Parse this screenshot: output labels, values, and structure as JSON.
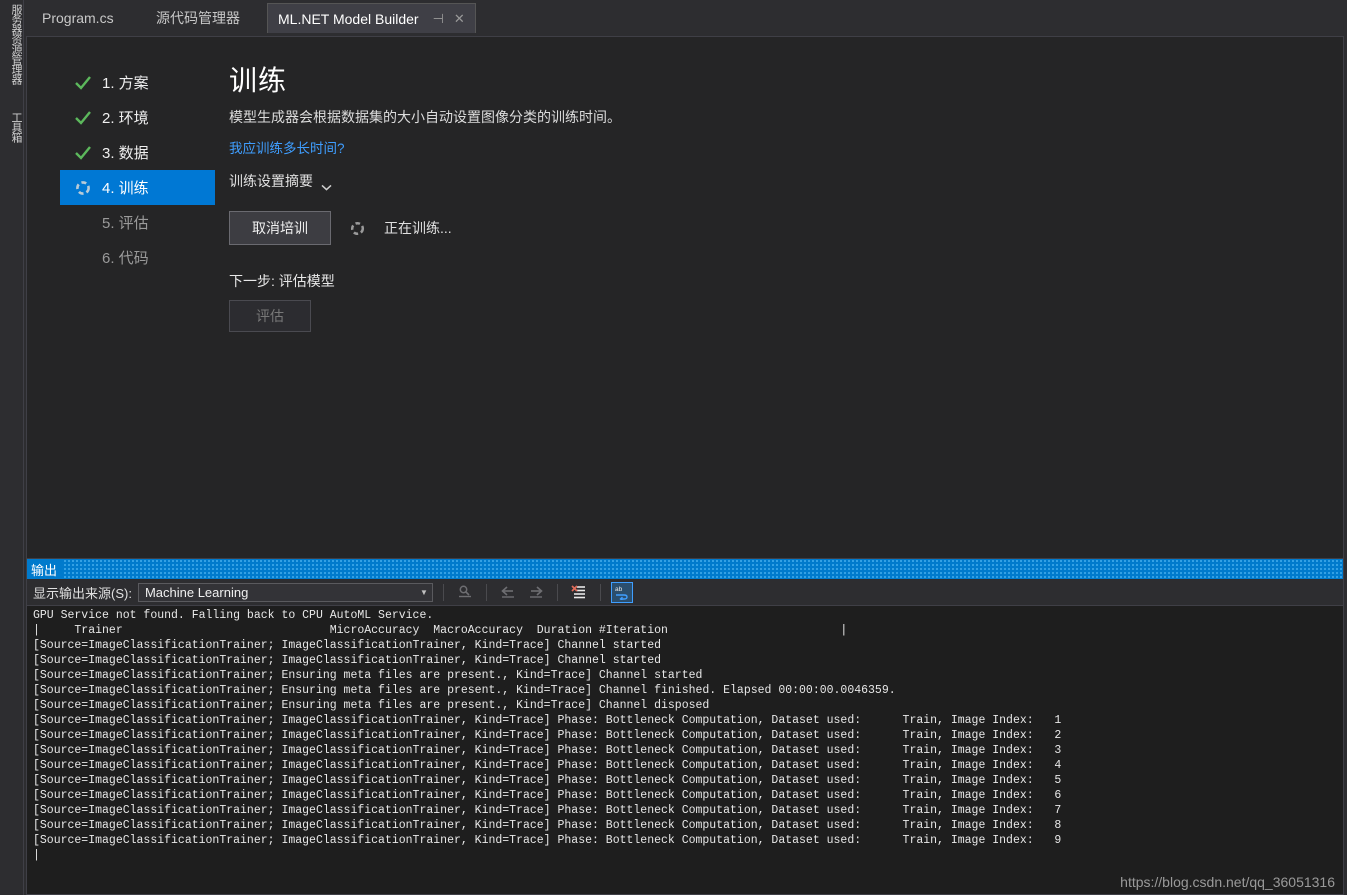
{
  "window": {
    "left_dock": {
      "items": [
        {
          "label": "服务器资源管理器"
        },
        {
          "label": "工具箱"
        }
      ]
    },
    "tabs": [
      {
        "label": "Program.cs",
        "active": false
      },
      {
        "label": "源代码管理器",
        "active": false
      },
      {
        "label": "ML.NET Model Builder",
        "active": true
      }
    ],
    "tab_pin_glyph": "⊣",
    "tab_close_glyph": "✕"
  },
  "wizard": {
    "steps": [
      {
        "label": "1. 方案",
        "state": "done"
      },
      {
        "label": "2. 环境",
        "state": "done"
      },
      {
        "label": "3. 数据",
        "state": "done"
      },
      {
        "label": "4. 训练",
        "state": "active"
      },
      {
        "label": "5. 评估",
        "state": "pending"
      },
      {
        "label": "6. 代码",
        "state": "pending"
      }
    ]
  },
  "main": {
    "title": "训练",
    "subtitle": "模型生成器会根据数据集的大小自动设置图像分类的训练时间。",
    "help_link": "我应训练多长时间?",
    "summary_toggle": "训练设置摘要",
    "cancel_button": "取消培训",
    "training_status": "正在训练...",
    "next_step_label": "下一步: 评估模型",
    "evaluate_button": "评估"
  },
  "output": {
    "panel_title": "输出",
    "source_label": "显示输出来源(S):",
    "source_value": "Machine Learning",
    "toolbar_buttons": [
      {
        "name": "find-message-source-icon",
        "enabled": false
      },
      {
        "name": "navigate-backward-icon",
        "enabled": false
      },
      {
        "name": "navigate-forward-icon",
        "enabled": false
      },
      {
        "name": "clear-all-icon",
        "enabled": true
      },
      {
        "name": "toggle-word-wrap-icon",
        "enabled": true,
        "active": true
      }
    ],
    "lines": [
      "GPU Service not found. Falling back to CPU AutoML Service.",
      "|     Trainer                              MicroAccuracy  MacroAccuracy  Duration #Iteration                         |",
      "[Source=ImageClassificationTrainer; ImageClassificationTrainer, Kind=Trace] Channel started",
      "[Source=ImageClassificationTrainer; ImageClassificationTrainer, Kind=Trace] Channel started",
      "[Source=ImageClassificationTrainer; Ensuring meta files are present., Kind=Trace] Channel started",
      "[Source=ImageClassificationTrainer; Ensuring meta files are present., Kind=Trace] Channel finished. Elapsed 00:00:00.0046359.",
      "[Source=ImageClassificationTrainer; Ensuring meta files are present., Kind=Trace] Channel disposed",
      "[Source=ImageClassificationTrainer; ImageClassificationTrainer, Kind=Trace] Phase: Bottleneck Computation, Dataset used:      Train, Image Index:   1",
      "[Source=ImageClassificationTrainer; ImageClassificationTrainer, Kind=Trace] Phase: Bottleneck Computation, Dataset used:      Train, Image Index:   2",
      "[Source=ImageClassificationTrainer; ImageClassificationTrainer, Kind=Trace] Phase: Bottleneck Computation, Dataset used:      Train, Image Index:   3",
      "[Source=ImageClassificationTrainer; ImageClassificationTrainer, Kind=Trace] Phase: Bottleneck Computation, Dataset used:      Train, Image Index:   4",
      "[Source=ImageClassificationTrainer; ImageClassificationTrainer, Kind=Trace] Phase: Bottleneck Computation, Dataset used:      Train, Image Index:   5",
      "[Source=ImageClassificationTrainer; ImageClassificationTrainer, Kind=Trace] Phase: Bottleneck Computation, Dataset used:      Train, Image Index:   6",
      "[Source=ImageClassificationTrainer; ImageClassificationTrainer, Kind=Trace] Phase: Bottleneck Computation, Dataset used:      Train, Image Index:   7",
      "[Source=ImageClassificationTrainer; ImageClassificationTrainer, Kind=Trace] Phase: Bottleneck Computation, Dataset used:      Train, Image Index:   8",
      "[Source=ImageClassificationTrainer; ImageClassificationTrainer, Kind=Trace] Phase: Bottleneck Computation, Dataset used:      Train, Image Index:   9",
      "|"
    ]
  },
  "watermark": "https://blog.csdn.net/qq_36051316",
  "colors": {
    "accent_blue": "#0078d4",
    "output_header_blue": "#007acc",
    "link_blue": "#3f9eff",
    "check_green": "#5cb85c",
    "window_bg": "#2d2d30",
    "doc_bg": "#252526",
    "output_bg": "#1e1e1e"
  }
}
